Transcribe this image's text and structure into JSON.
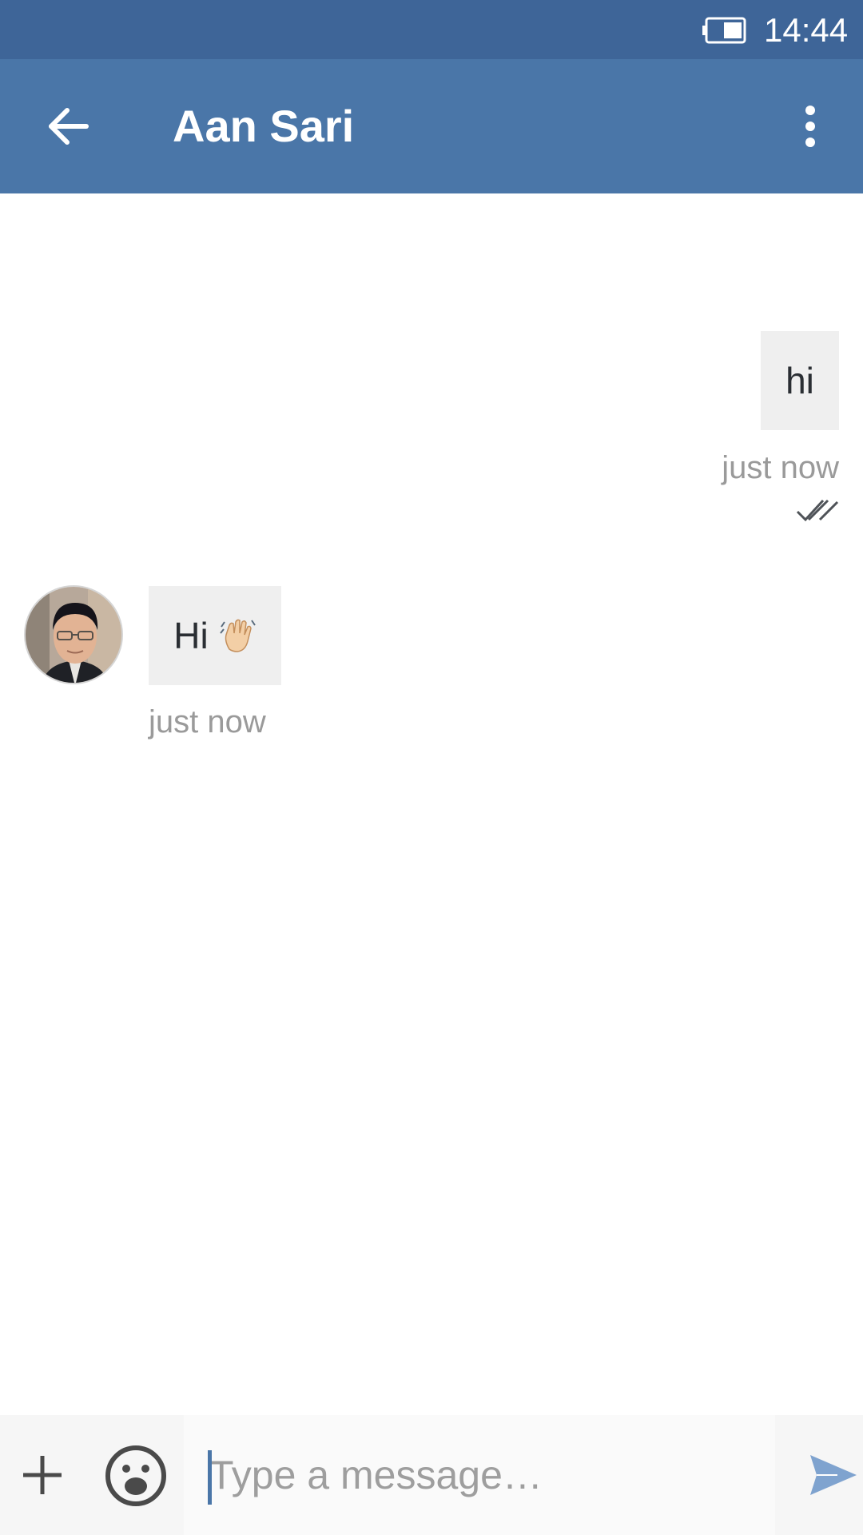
{
  "status_bar": {
    "time": "14:44",
    "battery_icon": "battery-icon"
  },
  "header": {
    "title": "Aan Sari",
    "back_icon": "arrow-left-icon",
    "menu_icon": "more-vert-icon"
  },
  "messages": [
    {
      "direction": "outgoing",
      "text": "hi",
      "time": "just now",
      "status_icon": "double-check-icon"
    },
    {
      "direction": "incoming",
      "text": "Hi",
      "emoji": "waving-hand-icon",
      "time": "just now",
      "avatar_icon": "avatar"
    }
  ],
  "composer": {
    "add_icon": "plus-icon",
    "emoji_icon": "smiley-icon",
    "placeholder": "Type a message…",
    "value": "",
    "send_icon": "send-icon"
  },
  "colors": {
    "status_bar": "#3e6598",
    "app_bar": "#4a76a8",
    "bubble": "#efefef",
    "timestamp": "#9a9a9a",
    "accent": "#4a76a8",
    "send": "#7fa3cf"
  }
}
